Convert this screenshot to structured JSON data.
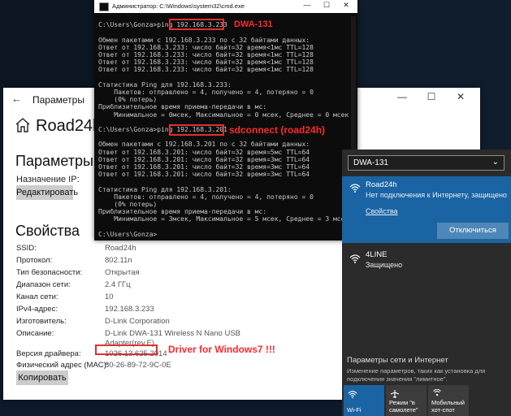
{
  "settings": {
    "title": "Параметры",
    "network_name": "Road24h",
    "ip_section": {
      "heading": "Параметры IP",
      "assign_label": "Назначение IP:",
      "edit_button": "Редактировать"
    },
    "props_section": {
      "heading": "Свойства",
      "rows": [
        {
          "key": "SSID:",
          "value": "Road24h"
        },
        {
          "key": "Протокол:",
          "value": "802.11n"
        },
        {
          "key": "Тип безопасности:",
          "value": "Открытая"
        },
        {
          "key": "Диапазон сети:",
          "value": "2.4 ГГц"
        },
        {
          "key": "Канал сети:",
          "value": "10"
        },
        {
          "key": "IPv4-адрес:",
          "value": "192.168.3.233"
        },
        {
          "key": "Изготовитель:",
          "value": "D-Link Corporation"
        },
        {
          "key": "Описание:",
          "value": "D-Link DWA-131 Wireless N Nano USB"
        },
        {
          "key": "",
          "value": "Adapter(rev.E)"
        },
        {
          "key": "Версия драйвера:",
          "value": "1026.13.625.2014"
        },
        {
          "key": "Физический адрес (MAC):",
          "value": "80-26-89-72-9C-0E"
        }
      ],
      "copy_button": "Копировать"
    },
    "controls": {
      "minimize": "—",
      "maximize": "☐",
      "close": "✕",
      "back": "←"
    }
  },
  "cmd": {
    "title": "Администратор: C:\\Windows\\system32\\cmd.exe",
    "controls": {
      "minimize": "—",
      "maximize": "☐",
      "close": "✕"
    },
    "lines": [
      "",
      "C:\\Users\\Gonza>ping 192.168.3.233",
      "",
      "Обмен пакетами с 192.168.3.233 по с 32 байтами данных:",
      "Ответ от 192.168.3.233: число байт=32 время<1мс TTL=128",
      "Ответ от 192.168.3.233: число байт=32 время<1мс TTL=128",
      "Ответ от 192.168.3.233: число байт=32 время<1мс TTL=128",
      "Ответ от 192.168.3.233: число байт=32 время<1мс TTL=128",
      "",
      "Статистика Ping для 192.168.3.233:",
      "    Пакетов: отправлено = 4, получено = 4, потеряно = 0",
      "    (0% потерь)",
      "Приблизительное время приема-передачи в мс:",
      "    Минимальное = 0мсек, Максимальное = 0 мсек, Среднее = 0 мсек",
      "",
      "C:\\Users\\Gonza>ping 192.168.3.201",
      "",
      "Обмен пакетами с 192.168.3.201 по с 32 байтами данных:",
      "Ответ от 192.168.3.201: число байт=32 время=5мс TTL=64",
      "Ответ от 192.168.3.201: число байт=32 время=3мс TTL=64",
      "Ответ от 192.168.3.201: число байт=32 время=3мс TTL=64",
      "Ответ от 192.168.3.201: число байт=32 время=3мс TTL=64",
      "",
      "Статистика Ping для 192.168.3.201:",
      "    Пакетов: отправлено = 4, получено = 4, потеряно = 0",
      "    (0% потерь)",
      "Приблизительное время приема-передачи в мс:",
      "    Минимальное = 3мсек, Максимальное = 5 мсек, Среднее = 3 мсек",
      "",
      "C:\\Users\\Gonza>"
    ]
  },
  "annotations": {
    "dwa": "DWA-131",
    "sdconnect": "sdconnect (road24h)",
    "driver": "Driver for Windows7 !!!"
  },
  "flyout": {
    "adapter": "DWA-131",
    "active_network": {
      "name": "Road24h",
      "status": "Нет подключения к Интернету, защищено",
      "properties_link": "Свойства",
      "disconnect_button": "Отключиться"
    },
    "other_network": {
      "name": "4LINE",
      "status": "Защищено"
    },
    "settings_link": "Параметры сети и Интернет",
    "settings_sub": "Изменение параметров, таких как установка для подключения значения \"лимитное\".",
    "tiles": [
      {
        "label": "Wi-Fi"
      },
      {
        "label": "Режим \"в самолете\""
      },
      {
        "label": "Мобильный хот-спот"
      }
    ]
  },
  "colors": {
    "accent": "#1a64a3",
    "highlight_box": "#e03030",
    "annotation": "#ff2a2a"
  }
}
